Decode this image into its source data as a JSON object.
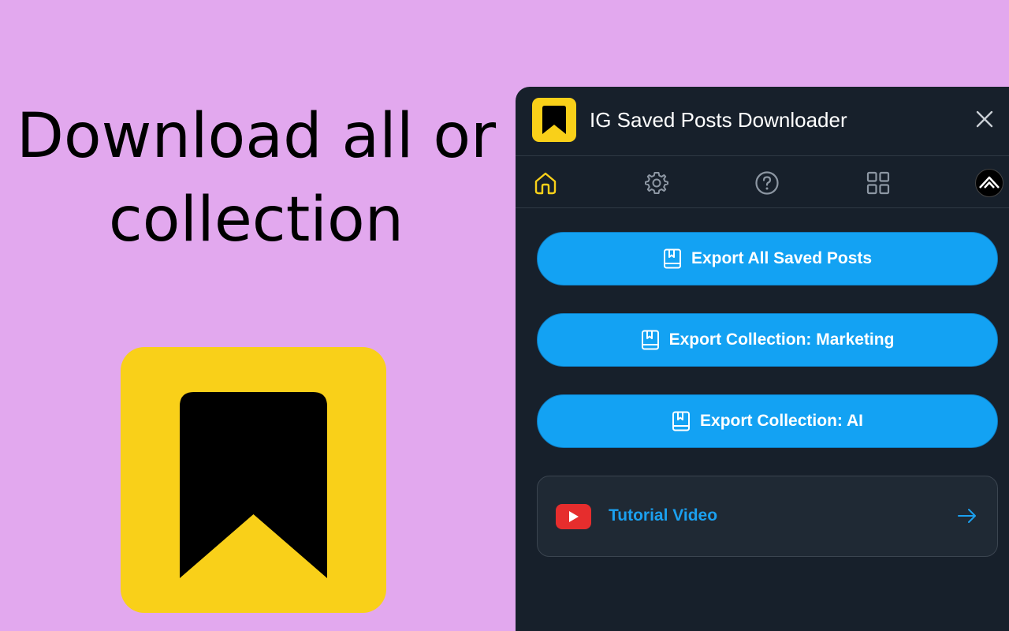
{
  "promo": {
    "headline_line1": "Download all or",
    "headline_line2": "collection"
  },
  "colors": {
    "background": "#e2a8ee",
    "brand_yellow": "#f9d019",
    "panel_bg": "#17202b",
    "button_blue": "#13a2f3",
    "link_blue": "#1ba0ef",
    "youtube_red": "#e62d2d"
  },
  "header": {
    "title": "IG Saved Posts Downloader",
    "logo_icon": "bookmark-icon",
    "close_icon": "close-icon"
  },
  "nav": {
    "items": [
      {
        "icon": "home-icon",
        "active": true
      },
      {
        "icon": "gear-icon",
        "active": false
      },
      {
        "icon": "help-icon",
        "active": false
      },
      {
        "icon": "grid-icon",
        "active": false
      },
      {
        "icon": "avatar-icon",
        "active": false
      }
    ]
  },
  "actions": {
    "export_all": "Export All Saved Posts",
    "export_marketing": "Export Collection: Marketing",
    "export_ai": "Export Collection: AI"
  },
  "tutorial": {
    "label": "Tutorial Video",
    "icon": "youtube-icon",
    "arrow_icon": "arrow-right-icon"
  }
}
